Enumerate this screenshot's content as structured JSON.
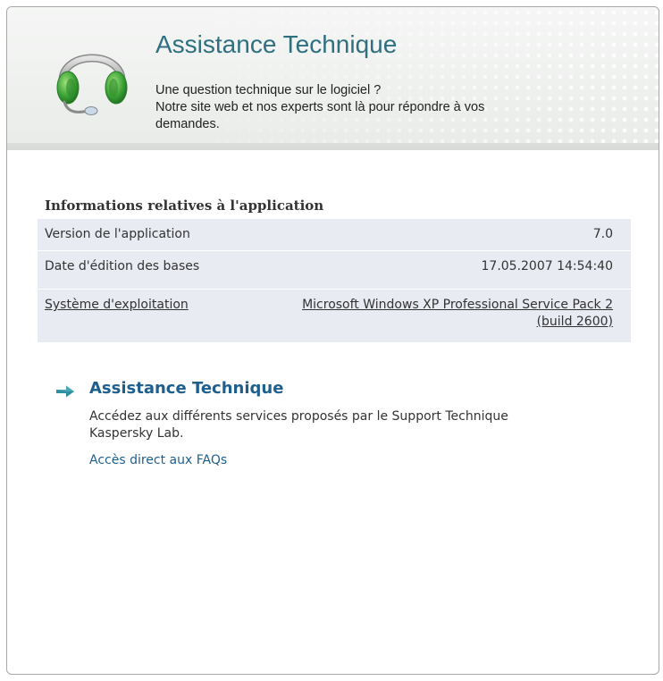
{
  "header": {
    "title": "Assistance Technique",
    "description_lines": [
      "Une question technique sur le logiciel ?",
      "Notre site web et nos experts sont là pour répondre à vos",
      "demandes."
    ],
    "icon": "headset-icon"
  },
  "info": {
    "heading": "Informations relatives à l'application",
    "rows": [
      {
        "label": "Version de l'application",
        "value": "7.0"
      },
      {
        "label": "Date d'édition des bases",
        "value": "17.05.2007 14:54:40"
      },
      {
        "label": "Système d'exploitation",
        "value_lines": [
          "Microsoft Windows XP Professional Service Pack 2",
          "(build 2600)"
        ]
      }
    ]
  },
  "support": {
    "title": "Assistance Technique",
    "description_lines": [
      "Accédez aux différents services proposés par le Support Technique",
      "Kaspersky Lab."
    ],
    "faq_link": "Accès direct aux FAQs",
    "icon": "arrow-right-icon"
  },
  "colors": {
    "title_teal": "#2f7080",
    "link_blue": "#1e5f8e",
    "table_bg": "#e9ebf2",
    "headset_green": "#3aa335"
  }
}
